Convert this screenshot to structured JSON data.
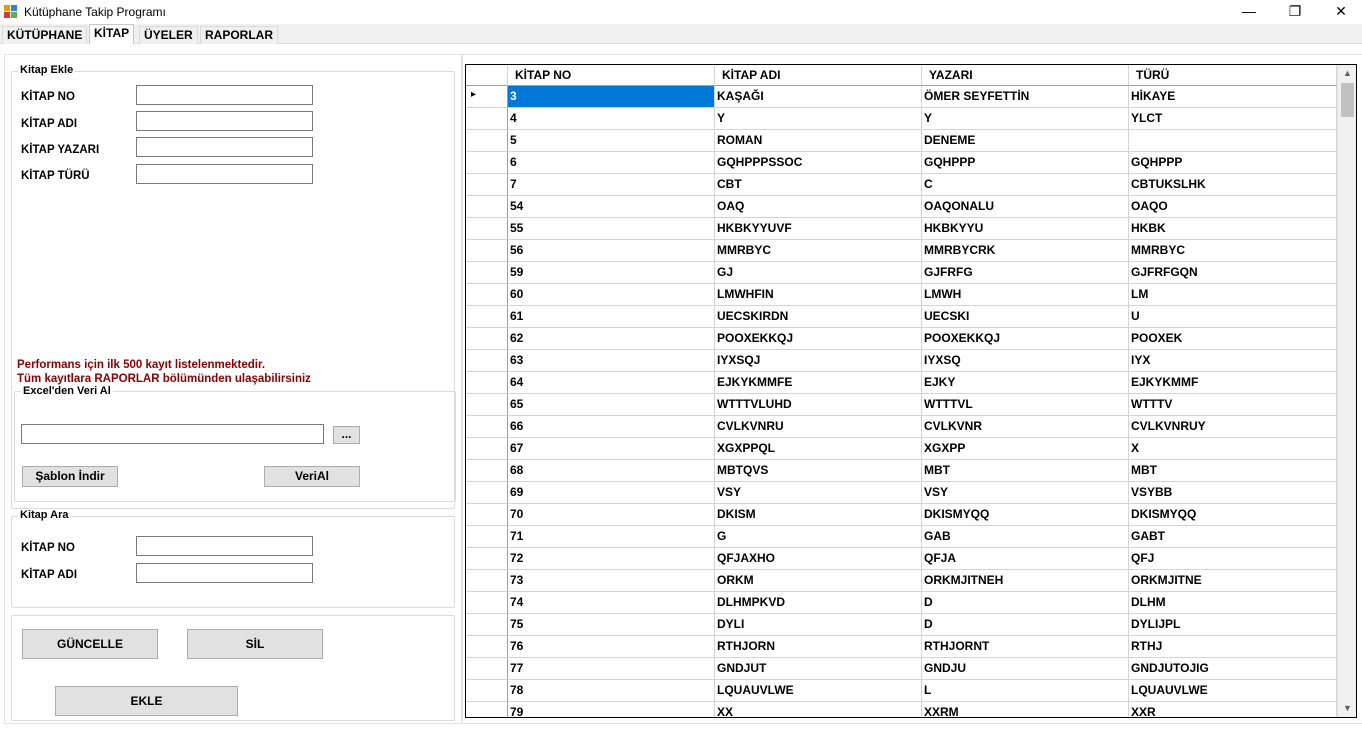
{
  "window": {
    "title": "Kütüphane Takip Programı",
    "minimize_glyph": "—",
    "maximize_glyph": "❐",
    "close_glyph": "✕"
  },
  "tabs": [
    "KÜTÜPHANE",
    "KİTAP",
    "ÜYELER",
    "RAPORLAR"
  ],
  "active_tab": "KİTAP",
  "add_group": {
    "legend": "Kitap Ekle",
    "no_label": "KİTAP NO",
    "name_label": "KİTAP ADI",
    "author_label": "KİTAP YAZARI",
    "type_label": "KİTAP TÜRÜ",
    "no_value": "",
    "name_value": "",
    "author_value": "",
    "type_value": ""
  },
  "notice": {
    "line1": "Performans için ilk 500 kayıt listelenmektedir.",
    "line2": "Tüm kayıtlara RAPORLAR bölümünden ulaşabilirsiniz",
    "color": "#8b0000"
  },
  "excel_group": {
    "legend": "Excel'den Veri Al",
    "path_value": "",
    "browse_label": "...",
    "template_button": "Şablon İndir",
    "import_button": "VeriAl"
  },
  "search_group": {
    "legend": "Kitap Ara",
    "no_label": "KİTAP NO",
    "name_label": "KİTAP ADI",
    "no_value": "",
    "name_value": ""
  },
  "actions": {
    "update_button": "GÜNCELLE",
    "delete_button": "SİL",
    "add_button": "EKLE"
  },
  "grid": {
    "columns": [
      "KİTAP NO",
      "KİTAP ADI",
      "YAZARI",
      "TÜRÜ"
    ],
    "current_row_glyph": "▸",
    "selected_color": "#0078d7",
    "scroll_up_glyph": "▲",
    "scroll_down_glyph": "▼",
    "rows": [
      [
        "3",
        "KAŞAĞI",
        "ÖMER SEYFETTİN",
        "HİKAYE"
      ],
      [
        "4",
        "Y",
        "Y",
        "YLCT"
      ],
      [
        "5",
        "ROMAN",
        "DENEME",
        ""
      ],
      [
        "6",
        "GQHPPPSSOC",
        "GQHPPP",
        "GQHPPP"
      ],
      [
        "7",
        "CBT",
        "C",
        "CBTUKSLHK"
      ],
      [
        "54",
        "OAQ",
        "OAQONALU",
        "OAQO"
      ],
      [
        "55",
        "HKBKYYUVF",
        "HKBKYYU",
        "HKBK"
      ],
      [
        "56",
        "MMRBYC",
        "MMRBYCRK",
        "MMRBYC"
      ],
      [
        "59",
        "GJ",
        "GJFRFG",
        "GJFRFGQN"
      ],
      [
        "60",
        "LMWHFIN",
        "LMWH",
        "LM"
      ],
      [
        "61",
        "UECSKIRDN",
        "UECSKI",
        "U"
      ],
      [
        "62",
        "POOXEKKQJ",
        "POOXEKKQJ",
        "POOXEK"
      ],
      [
        "63",
        "IYXSQJ",
        "IYXSQ",
        "IYX"
      ],
      [
        "64",
        "EJKYKMMFE",
        "EJKY",
        "EJKYKMMF"
      ],
      [
        "65",
        "WTTTVLUHD",
        "WTTTVL",
        "WTTTV"
      ],
      [
        "66",
        "CVLKVNRU",
        "CVLKVNR",
        "CVLKVNRUY"
      ],
      [
        "67",
        "XGXPPQL",
        "XGXPP",
        "X"
      ],
      [
        "68",
        "MBTQVS",
        "MBT",
        "MBT"
      ],
      [
        "69",
        "VSY",
        "VSY",
        "VSYBB"
      ],
      [
        "70",
        "DKISM",
        "DKISMYQQ",
        "DKISMYQQ"
      ],
      [
        "71",
        "G",
        "GAB",
        "GABT"
      ],
      [
        "72",
        "QFJAXHO",
        "QFJA",
        "QFJ"
      ],
      [
        "73",
        "ORKM",
        "ORKMJITNEH",
        "ORKMJITNE"
      ],
      [
        "74",
        "DLHMPKVD",
        "D",
        "DLHM"
      ],
      [
        "75",
        "DYLI",
        "D",
        "DYLIJPL"
      ],
      [
        "76",
        "RTHJORN",
        "RTHJORNT",
        "RTHJ"
      ],
      [
        "77",
        "GNDJUT",
        "GNDJU",
        "GNDJUTOJIG"
      ],
      [
        "78",
        "LQUAUVLWE",
        "L",
        "LQUAUVLWE"
      ],
      [
        "79",
        "XX",
        "XXRM",
        "XXR"
      ]
    ]
  }
}
